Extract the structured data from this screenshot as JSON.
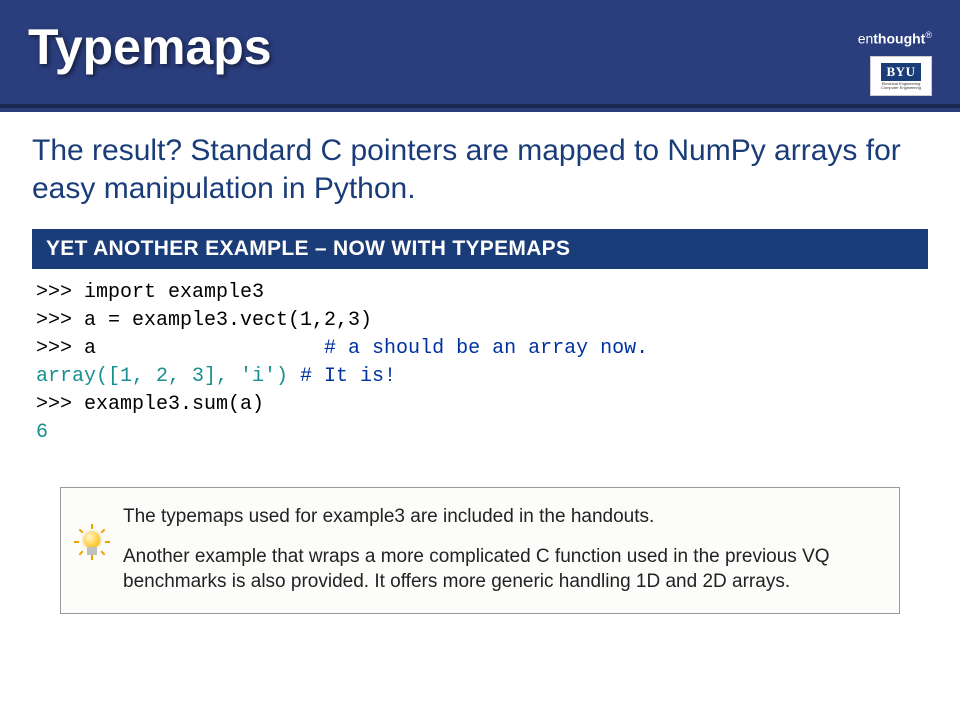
{
  "header": {
    "title": "Typemaps",
    "brand_light": "en",
    "brand_bold": "thought",
    "brand_reg": "®",
    "logo_text": "BYU",
    "logo_sub": "Electrical Engineering Computer Engineering"
  },
  "intro": "The result?   Standard C pointers are mapped to NumPy arrays for easy manipulation in Python.",
  "section_title": "YET ANOTHER EXAMPLE – NOW WITH TYPEMAPS",
  "code": {
    "l1_a": ">>> import example3",
    "l2_a": ">>> a = example3.vect(1,2,3)",
    "l3_a": ">>> a                   ",
    "l3_b": "# a should be an array now.",
    "l4_a": "array([1, 2, 3], 'i') ",
    "l4_b": "# It is!",
    "l5_a": ">>> example3.sum(a)",
    "l6_a": "6"
  },
  "callout": {
    "p1": "The typemaps used for example3 are included in the handouts.",
    "p2": "Another example that wraps a more complicated C function used in the previous VQ benchmarks is also provided.  It offers more generic handling 1D and 2D arrays."
  }
}
